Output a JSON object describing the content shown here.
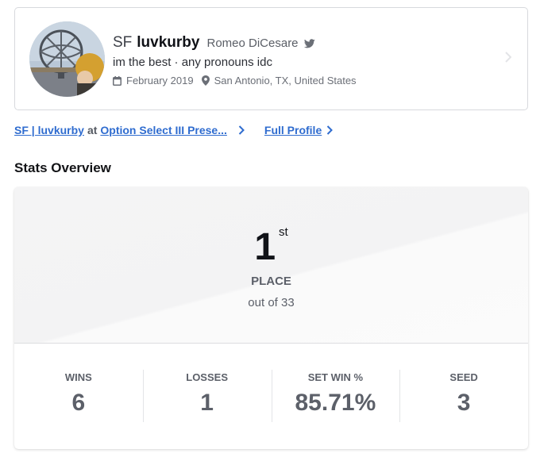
{
  "profile": {
    "prefix": "SF",
    "gamertag": "luvkurby",
    "real_name": "Romeo DiCesare",
    "bio": "im the best · any pronouns idc",
    "joined": "February 2019",
    "location": "San Antonio, TX, United States",
    "icons": [
      "avatar",
      "twitter-icon",
      "calendar-icon",
      "location-pin-icon",
      "chevron-right-icon"
    ]
  },
  "links": {
    "player_link": "SF | luvkurby",
    "at": "at",
    "event_link": "Option Select III Prese...",
    "full_profile": "Full Profile"
  },
  "stats": {
    "section_title": "Stats Overview",
    "place_number": "1",
    "place_suffix": "st",
    "place_label": "PLACE",
    "place_sub": "out of 33",
    "items": [
      {
        "label": "WINS",
        "value": "6"
      },
      {
        "label": "LOSSES",
        "value": "1"
      },
      {
        "label": "SET WIN %",
        "value": "85.71%"
      },
      {
        "label": "SEED",
        "value": "3"
      }
    ]
  },
  "colors": {
    "link": "#2f6ccf",
    "muted": "#5c6069",
    "border": "#d7d9dd"
  }
}
